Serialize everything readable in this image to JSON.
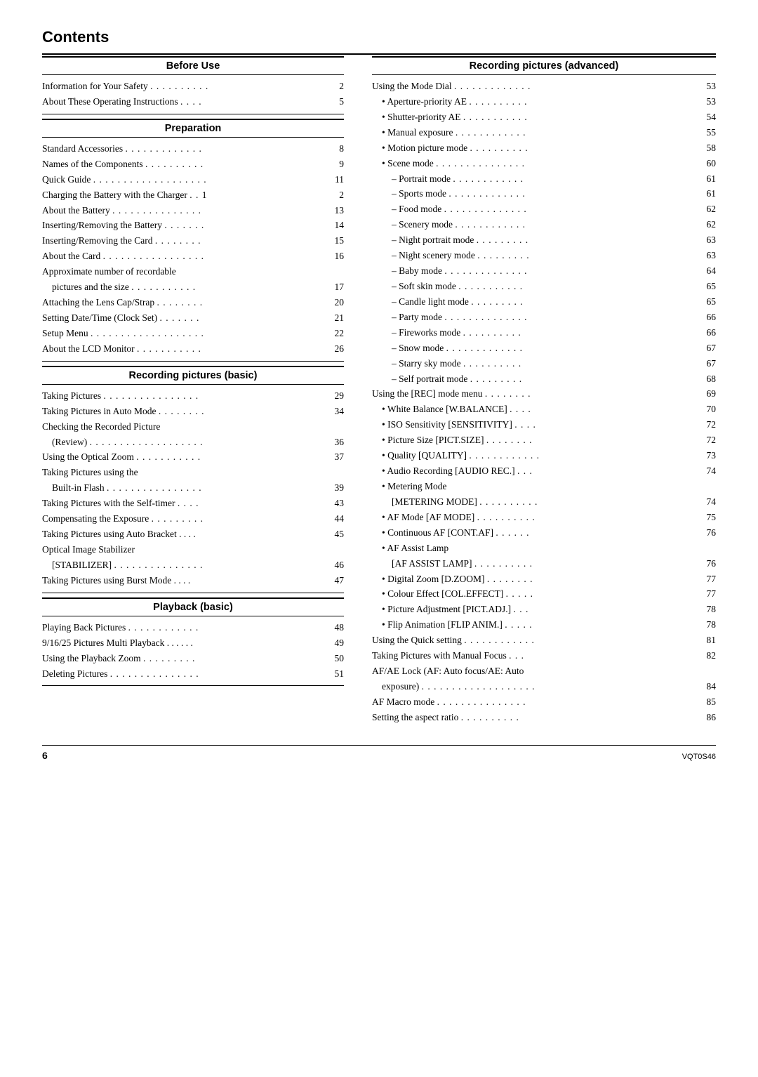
{
  "title": "Contents",
  "left_column": {
    "sections": [
      {
        "header": "Before Use",
        "entries": [
          {
            "text": "Information for Your Safety",
            "dots": " . . . . . . . . . .",
            "page": "2"
          },
          {
            "text": "About These Operating Instructions",
            "dots": " . . . .",
            "page": "5"
          }
        ]
      },
      {
        "header": "Preparation",
        "entries": [
          {
            "text": "Standard Accessories",
            "dots": " . . . . . . . . . . . . .",
            "page": "8"
          },
          {
            "text": "Names of the Components",
            "dots": " . . . . . . . . . .",
            "page": "9"
          },
          {
            "text": "Quick Guide",
            "dots": " . . . . . . . . . . . . . . . . . . .",
            "page": "11"
          },
          {
            "text": "Charging the Battery with the Charger",
            "dots": " . . 1",
            "page": "2"
          },
          {
            "text": "About the Battery",
            "dots": " . . . . . . . . . . . . . . .",
            "page": "13"
          },
          {
            "text": "Inserting/Removing the Battery",
            "dots": " . . . . . . .",
            "page": "14"
          },
          {
            "text": "Inserting/Removing the Card",
            "dots": " . . . . . . . .",
            "page": "15"
          },
          {
            "text": "About the Card",
            "dots": " . . . . . . . . . . . . . . . . .",
            "page": "16"
          },
          {
            "text": "Approximate number of recordable",
            "dots": "",
            "page": ""
          },
          {
            "text": "pictures and the size",
            "dots": " . . . . . . . . . . .",
            "page": "17",
            "indent": 1
          },
          {
            "text": "Attaching the Lens Cap/Strap",
            "dots": " . . . . . . . .",
            "page": "20"
          },
          {
            "text": "Setting Date/Time (Clock Set)",
            "dots": " . . . . . . .",
            "page": "21"
          },
          {
            "text": "Setup Menu",
            "dots": " . . . . . . . . . . . . . . . . . . .",
            "page": "22"
          },
          {
            "text": "About the LCD Monitor",
            "dots": " . . . . . . . . . . .",
            "page": "26"
          }
        ]
      },
      {
        "header": "Recording pictures (basic)",
        "entries": [
          {
            "text": "Taking Pictures",
            "dots": " . . . . . . . . . . . . . . . .",
            "page": "29"
          },
          {
            "text": "Taking Pictures in Auto Mode",
            "dots": " . . . . . . . .",
            "page": "34"
          },
          {
            "text": "Checking the Recorded Picture",
            "dots": "",
            "page": ""
          },
          {
            "text": "(Review)",
            "dots": " . . . . . . . . . . . . . . . . . . .",
            "page": "36",
            "indent": 1
          },
          {
            "text": "Using the Optical Zoom",
            "dots": " . . . . . . . . . . .",
            "page": "37"
          },
          {
            "text": "Taking Pictures using the",
            "dots": "",
            "page": ""
          },
          {
            "text": "Built-in Flash",
            "dots": " . . . . . . . . . . . . . . . .",
            "page": "39",
            "indent": 1
          },
          {
            "text": "Taking Pictures with the Self-timer",
            "dots": " . . . .",
            "page": "43"
          },
          {
            "text": "Compensating the Exposure",
            "dots": " . . . . . . . . .",
            "page": "44"
          },
          {
            "text": "Taking Pictures using Auto Bracket . . . .",
            "dots": "",
            "page": "45"
          },
          {
            "text": "Optical Image Stabilizer",
            "dots": "",
            "page": ""
          },
          {
            "text": "[STABILIZER]",
            "dots": " . . . . . . . . . . . . . . .",
            "page": "46",
            "indent": 1
          },
          {
            "text": "Taking Pictures using Burst Mode . . . .",
            "dots": "",
            "page": "47"
          }
        ]
      },
      {
        "header": "Playback (basic)",
        "entries": [
          {
            "text": "Playing Back Pictures",
            "dots": " . . . . . . . . . . . .",
            "page": "48"
          },
          {
            "text": "9/16/25 Pictures Multi Playback . . . . . .",
            "dots": "",
            "page": "49"
          },
          {
            "text": "Using the Playback Zoom",
            "dots": " . . . . . . . . .",
            "page": "50"
          },
          {
            "text": "Deleting Pictures",
            "dots": " . . . . . . . . . . . . . . .",
            "page": "51"
          }
        ]
      }
    ]
  },
  "right_column": {
    "sections": [
      {
        "header": "Recording pictures (advanced)",
        "entries": [
          {
            "text": "Using the Mode Dial",
            "dots": " . . . . . . . . . . . . .",
            "page": "53"
          },
          {
            "text": "• Aperture-priority AE",
            "dots": " . . . . . . . . . .",
            "page": "53",
            "indent": 1
          },
          {
            "text": "• Shutter-priority AE",
            "dots": " . . . . . . . . . . .",
            "page": "54",
            "indent": 1
          },
          {
            "text": "• Manual exposure",
            "dots": " . . . . . . . . . . . .",
            "page": "55",
            "indent": 1
          },
          {
            "text": "• Motion picture mode",
            "dots": " . . . . . . . . . .",
            "page": "58",
            "indent": 1
          },
          {
            "text": "• Scene mode",
            "dots": " . . . . . . . . . . . . . . .",
            "page": "60",
            "indent": 1
          },
          {
            "text": "– Portrait mode",
            "dots": " . . . . . . . . . . . .",
            "page": "61",
            "indent": 2
          },
          {
            "text": "– Sports mode",
            "dots": " . . . . . . . . . . . . .",
            "page": "61",
            "indent": 2
          },
          {
            "text": "– Food mode",
            "dots": " . . . . . . . . . . . . . .",
            "page": "62",
            "indent": 2
          },
          {
            "text": "– Scenery mode",
            "dots": " . . . . . . . . . . . .",
            "page": "62",
            "indent": 2
          },
          {
            "text": "– Night portrait mode",
            "dots": " . . . . . . . . .",
            "page": "63",
            "indent": 2
          },
          {
            "text": "– Night scenery mode",
            "dots": " . . . . . . . . .",
            "page": "63",
            "indent": 2
          },
          {
            "text": "– Baby mode",
            "dots": " . . . . . . . . . . . . . .",
            "page": "64",
            "indent": 2
          },
          {
            "text": "– Soft skin mode",
            "dots": " . . . . . . . . . . .",
            "page": "65",
            "indent": 2
          },
          {
            "text": "– Candle light mode",
            "dots": " . . . . . . . . .",
            "page": "65",
            "indent": 2
          },
          {
            "text": "– Party mode",
            "dots": " . . . . . . . . . . . . . .",
            "page": "66",
            "indent": 2
          },
          {
            "text": "– Fireworks mode",
            "dots": " . . . . . . . . . .",
            "page": "66",
            "indent": 2
          },
          {
            "text": "– Snow mode",
            "dots": " . . . . . . . . . . . . .",
            "page": "67",
            "indent": 2
          },
          {
            "text": "– Starry sky mode",
            "dots": " . . . . . . . . . .",
            "page": "67",
            "indent": 2
          },
          {
            "text": "– Self portrait mode",
            "dots": " . . . . . . . . .",
            "page": "68",
            "indent": 2
          },
          {
            "text": "Using the [REC] mode menu",
            "dots": " . . . . . . . .",
            "page": "69"
          },
          {
            "text": "• White Balance [W.BALANCE]",
            "dots": " . . . .",
            "page": "70",
            "indent": 1
          },
          {
            "text": "• ISO Sensitivity [SENSITIVITY]",
            "dots": " . . . .",
            "page": "72",
            "indent": 1
          },
          {
            "text": "• Picture Size [PICT.SIZE]",
            "dots": " . . . . . . . .",
            "page": "72",
            "indent": 1
          },
          {
            "text": "• Quality [QUALITY]",
            "dots": " . . . . . . . . . . . .",
            "page": "73",
            "indent": 1
          },
          {
            "text": "• Audio Recording [AUDIO REC.]",
            "dots": " . . .",
            "page": "74",
            "indent": 1
          },
          {
            "text": "• Metering Mode",
            "dots": "",
            "page": "",
            "indent": 1
          },
          {
            "text": "[METERING MODE]",
            "dots": " . . . . . . . . . .",
            "page": "74",
            "indent": 2
          },
          {
            "text": "• AF Mode [AF MODE]",
            "dots": " . . . . . . . . . .",
            "page": "75",
            "indent": 1
          },
          {
            "text": "• Continuous AF [CONT.AF]",
            "dots": " . . . . . .",
            "page": "76",
            "indent": 1
          },
          {
            "text": "• AF Assist Lamp",
            "dots": "",
            "page": "",
            "indent": 1
          },
          {
            "text": "[AF ASSIST LAMP]",
            "dots": " . . . . . . . . . .",
            "page": "76",
            "indent": 2
          },
          {
            "text": "• Digital Zoom [D.ZOOM]",
            "dots": " . . . . . . . .",
            "page": "77",
            "indent": 1
          },
          {
            "text": "• Colour Effect [COL.EFFECT]",
            "dots": " . . . . .",
            "page": "77",
            "indent": 1
          },
          {
            "text": "• Picture Adjustment [PICT.ADJ.]",
            "dots": " . . .",
            "page": "78",
            "indent": 1
          },
          {
            "text": "• Flip Animation [FLIP ANIM.]",
            "dots": " . . . . .",
            "page": "78",
            "indent": 1
          },
          {
            "text": "Using the Quick setting",
            "dots": " . . . . . . . . . . . .",
            "page": "81"
          },
          {
            "text": "Taking Pictures with Manual Focus",
            "dots": " . . .",
            "page": "82"
          },
          {
            "text": "AF/AE Lock (AF: Auto focus/AE: Auto",
            "dots": "",
            "page": ""
          },
          {
            "text": "exposure)",
            "dots": " . . . . . . . . . . . . . . . . . . .",
            "page": "84",
            "indent": 1
          },
          {
            "text": "AF Macro mode",
            "dots": " . . . . . . . . . . . . . . .",
            "page": "85"
          },
          {
            "text": "Setting the aspect ratio",
            "dots": " . . . . . . . . . .",
            "page": "86"
          }
        ]
      }
    ]
  },
  "footer": {
    "page_number": "6",
    "model": "VQT0S46"
  }
}
